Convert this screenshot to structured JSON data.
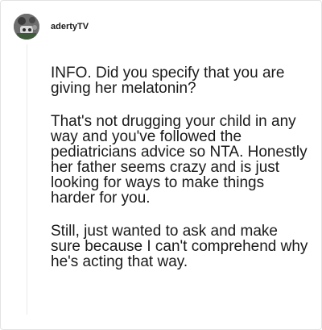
{
  "comment": {
    "username": "adertyTV",
    "avatar_icon": "user-avatar",
    "paragraphs": [
      "INFO. Did you specify that you are giving her melatonin?",
      "That's not drugging your child in any way and you've followed the pediatricians advice so NTA. Honestly her father seems crazy and is just looking for ways to make things harder for you.",
      "Still, just wanted to ask and make sure because I can't comprehend why he's acting that way."
    ]
  }
}
